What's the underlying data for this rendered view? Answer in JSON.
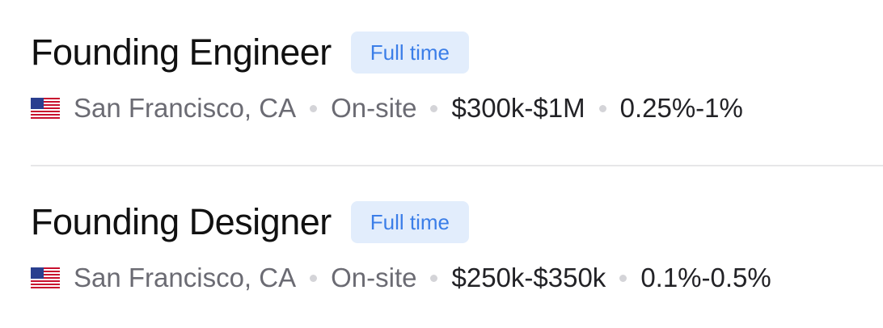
{
  "jobs": [
    {
      "title": "Founding Engineer",
      "badge": "Full time",
      "location": "San Francisco, CA",
      "workplace": "On-site",
      "salary": "$300k-$1M",
      "equity": "0.25%-1%",
      "flag_icon": "us-flag-icon"
    },
    {
      "title": "Founding Designer",
      "badge": "Full time",
      "location": "San Francisco, CA",
      "workplace": "On-site",
      "salary": "$250k-$350k",
      "equity": "0.1%-0.5%",
      "flag_icon": "us-flag-icon"
    }
  ],
  "colors": {
    "badge_bg": "#e2edfc",
    "badge_text": "#3b7ee8",
    "muted_text": "#6b6b73",
    "strong_text": "#222226",
    "separator_dot": "#d4d4d8"
  }
}
